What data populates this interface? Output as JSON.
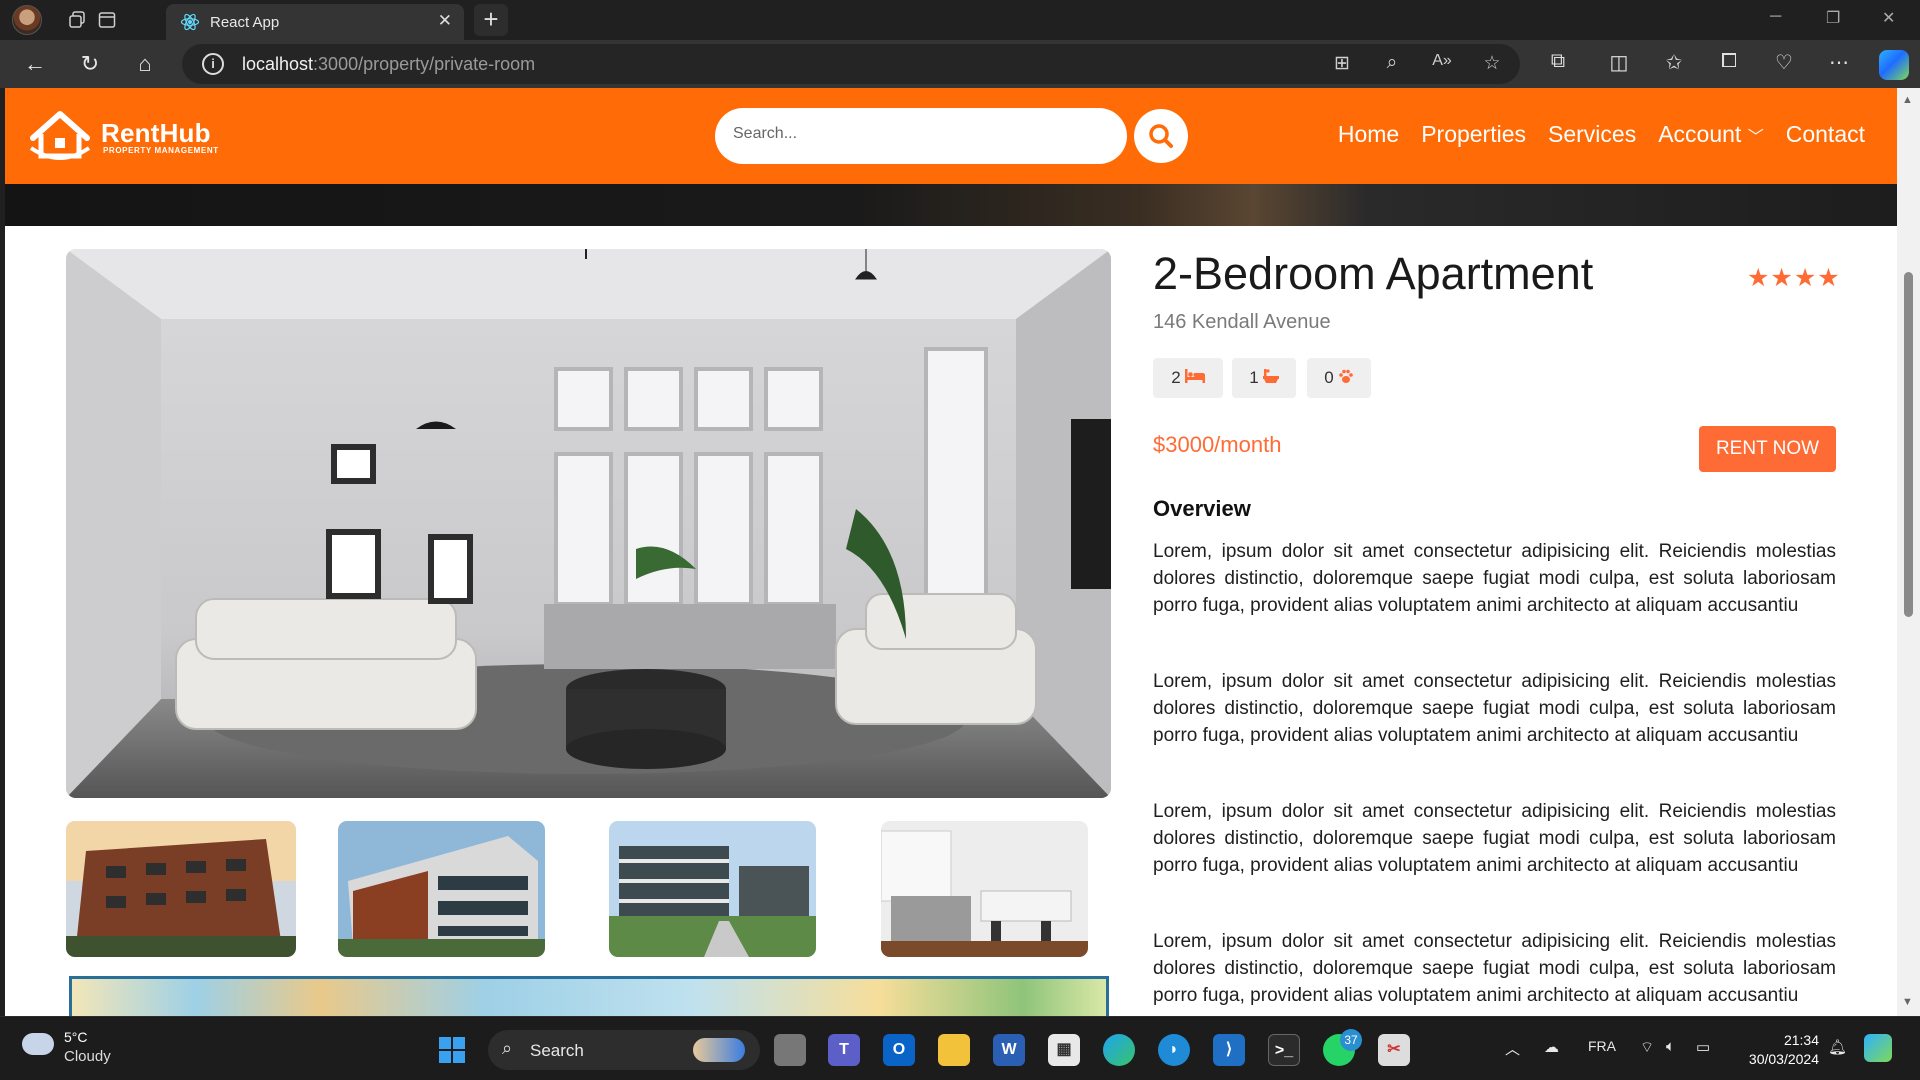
{
  "browser": {
    "tab_title": "React App",
    "url_host": "localhost",
    "url_path": ":3000/property/private-room",
    "new_tab_symbol": "+",
    "close_tab_symbol": "✕"
  },
  "site": {
    "brand": "RentHub",
    "brand_sub": "PROPERTY MANAGEMENT",
    "accent": "#ff6b06",
    "search_placeholder": "Search...",
    "nav": [
      "Home",
      "Properties",
      "Services",
      "Account",
      "Contact"
    ]
  },
  "property": {
    "title": "2-Bedroom Apartment",
    "stars": "★★★★",
    "address": "146 Kendall Avenue",
    "bedrooms": "2",
    "bathrooms": "1",
    "pets": "0",
    "price": "$3000/month",
    "rent_button": "RENT NOW",
    "overview_heading": "Overview",
    "paragraphs": [
      "Lorem, ipsum dolor sit amet consectetur adipisicing elit. Reiciendis molestias dolores distinctio, doloremque saepe fugiat modi culpa, est soluta laboriosam porro fuga, provident alias voluptatem animi architecto at aliquam accusantiu",
      "Lorem, ipsum dolor sit amet consectetur adipisicing elit. Reiciendis molestias dolores distinctio, doloremque saepe fugiat modi culpa, est soluta laboriosam porro fuga, provident alias voluptatem animi architecto at aliquam accusantiu",
      "Lorem, ipsum dolor sit amet consectetur adipisicing elit. Reiciendis molestias dolores distinctio, doloremque saepe fugiat modi culpa, est soluta laboriosam porro fuga, provident alias voluptatem animi architecto at aliquam accusantiu",
      "Lorem, ipsum dolor sit amet consectetur adipisicing elit. Reiciendis molestias dolores distinctio, doloremque saepe fugiat modi culpa, est soluta laboriosam porro fuga, provident alias voluptatem animi architecto at aliquam accusantiu"
    ]
  },
  "taskbar": {
    "temperature": "5°C",
    "condition": "Cloudy",
    "search_label": "Search",
    "whatsapp_badge": "37",
    "language": "FRA",
    "time": "21:34",
    "date": "30/03/2024"
  }
}
